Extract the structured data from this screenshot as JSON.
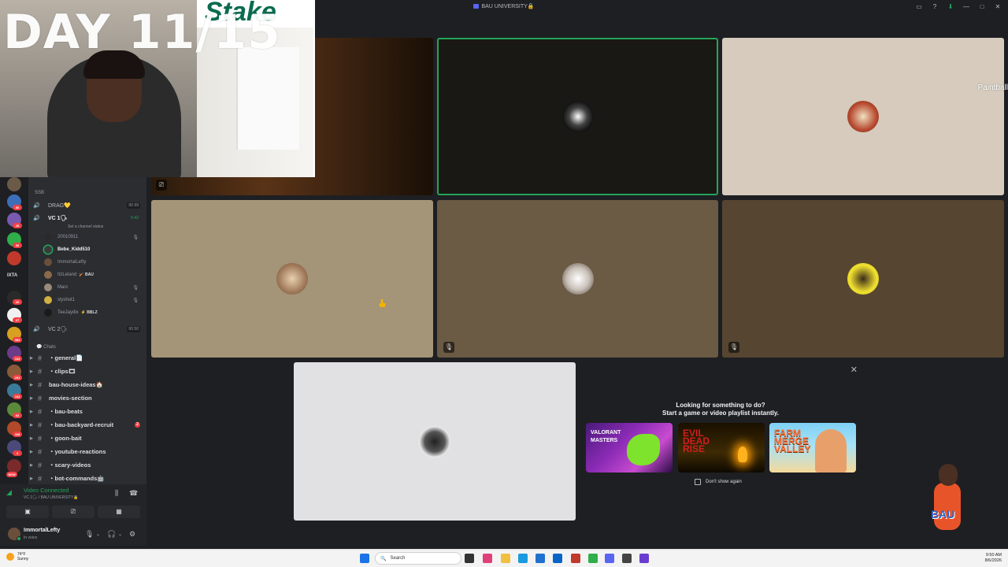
{
  "window": {
    "title": "BAU UNIVERSITY🔒"
  },
  "overlay": {
    "day_text": "DAY 11/15",
    "sign_text": "Stake"
  },
  "sidebar": {
    "category_ssb": "SSB",
    "voice_channels": [
      {
        "name": "DRAG💛",
        "count": "00 99"
      },
      {
        "name": "VC 1🗣",
        "timer": "5:42",
        "status": "Set a channel status"
      },
      {
        "name": "VC 2🗣",
        "count": "00 50"
      }
    ],
    "members": [
      {
        "name": "20010911",
        "tag": ""
      },
      {
        "name": "Bebe_Kidd510",
        "tag": ""
      },
      {
        "name": "ImmortalLefty",
        "tag": ""
      },
      {
        "name": "ItzLeland",
        "tag": "🏏 BAU"
      },
      {
        "name": "Marc",
        "tag": ""
      },
      {
        "name": "slyshot1",
        "tag": ""
      },
      {
        "name": "TeeJaydix",
        "tag": "⚡ BBLZ"
      }
    ],
    "chats_category": "Chats",
    "channels": [
      {
        "name": "・general📄"
      },
      {
        "name": "・clips🎞"
      },
      {
        "name": "bau-house-ideas🏠"
      },
      {
        "name": "movies-section"
      },
      {
        "name": "・bau-beats"
      },
      {
        "name": "・bau-backyard-recruit",
        "unread": "2"
      },
      {
        "name": "・goon-bait"
      },
      {
        "name": "・youtube-reactions"
      },
      {
        "name": "・scary-videos"
      },
      {
        "name": "・bot-commands🤖"
      }
    ],
    "rail_badges": [
      "80",
      "28",
      "36",
      "20",
      "27",
      "3",
      "584",
      "164",
      "291",
      "164",
      "63",
      "428",
      "NEW"
    ],
    "rail_text": "IXTA"
  },
  "voice_panel": {
    "status": "Video Connected",
    "location": "VC 1🗣 / BAU UNIVERSITY🔒"
  },
  "user": {
    "name": "ImmortalLefty",
    "status": "In voice"
  },
  "stage": {
    "side_label": "Paintball"
  },
  "activity": {
    "headline": "Looking for something to do?",
    "subline": "Start a game or video playlist instantly.",
    "games": [
      {
        "title": "VALORANT MASTERS"
      },
      {
        "title": "EVIL DEAD RISE"
      },
      {
        "title": "FARM MERGE VALLEY"
      }
    ],
    "dont_show": "Don't show again"
  },
  "mascot_text": "BAU",
  "taskbar": {
    "weather_temp": "74°F",
    "weather_desc": "Sunny",
    "search_placeholder": "Search",
    "time": "9:50 AM",
    "date": "8/6/2026"
  },
  "colors": {
    "accent_green": "#23a55a",
    "blurple": "#5865f2",
    "danger": "#f23f43"
  }
}
